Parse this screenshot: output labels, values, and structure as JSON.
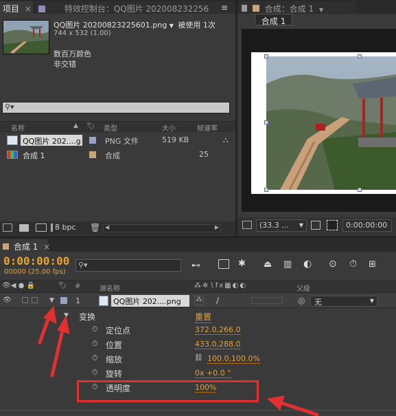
{
  "project_panel": {
    "tab_label": "项目",
    "effects_tab_label": "特效控制台：QQ图片 202008232256",
    "menu_glyph": "≡",
    "file_name": "QQ图片 20200823225601.png",
    "used_label": "被使用 1次",
    "dimensions": "744 x 532 (1.00)",
    "color_desc": "数百万颜色",
    "interlace_desc": "非交错",
    "search_placeholder": "",
    "columns": {
      "name": "名称",
      "type": "类型",
      "size": "大小",
      "framerate": "帧速率"
    },
    "items": [
      {
        "name": "QQ图片 202....g",
        "type": "PNG 文件",
        "size": "519 KB",
        "framerate": "",
        "label_color": "#9aa0c8"
      },
      {
        "name": "合成 1",
        "type": "合成",
        "size": "",
        "framerate": "25",
        "label_color": "#c9a57a"
      }
    ],
    "bpc_label": "8 bpc"
  },
  "comp_viewer": {
    "tab_label": "合成：合成 1",
    "subtab_label": "合成 1",
    "zoom_label": "(33.3 ...",
    "timecode": "0:00:00:00"
  },
  "timeline": {
    "tab_label": "合成 1",
    "timecode": "0:00:00:00",
    "frame_info": "00000 (25.00 fps)",
    "col_number": "#",
    "col_source": "源名称",
    "col_parent": "父级",
    "layer_number": "1",
    "layer_name": "QQ图片 202....png",
    "parent_value": "无",
    "transform_label": "变换",
    "reset_label": "重置",
    "properties": [
      {
        "name": "定位点",
        "value": "372.0,266.0"
      },
      {
        "name": "位置",
        "value": "433.0,288.0"
      },
      {
        "name": "缩放",
        "value": "100.0,100.0%"
      },
      {
        "name": "旋转",
        "value": "0x +0.0 °"
      },
      {
        "name": "透明度",
        "value": "100%"
      }
    ]
  },
  "colors": {
    "accent": "#e6a234",
    "annotation_red": "#e23030",
    "panel": "#3a3a3a"
  }
}
